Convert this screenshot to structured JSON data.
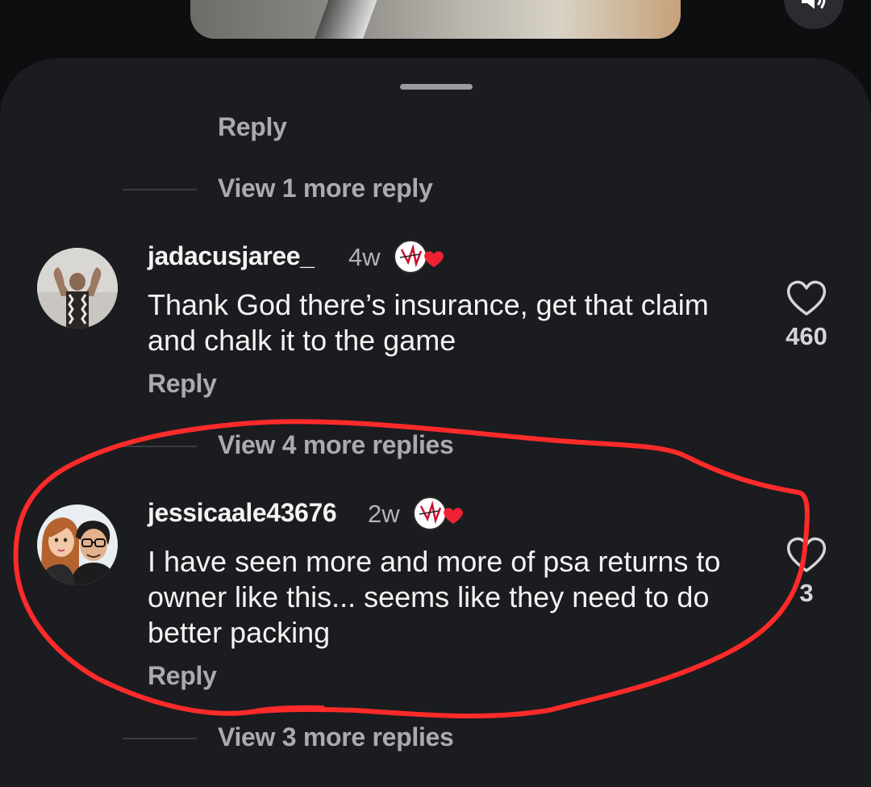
{
  "video": {
    "sound_icon": "speaker-icon"
  },
  "comments": {
    "prev_thread": {
      "reply_label": "Reply",
      "view_more_label": "View 1 more reply"
    },
    "items": [
      {
        "username": "jadacusjaree_",
        "time": "4w",
        "text": "Thank God there’s insurance, get that claim and chalk it to the game",
        "reply_label": "Reply",
        "likes": "460",
        "view_more_label": "View 4 more replies"
      },
      {
        "username": "jessicaale43676",
        "time": "2w",
        "text": "I have seen more and more of psa returns to owner like this... seems like they need to do better packing",
        "reply_label": "Reply",
        "likes": "3",
        "view_more_label": "View 3 more replies"
      }
    ]
  },
  "colors": {
    "sheet_bg": "#1b1c1f",
    "annotation_red": "#ff2a2a",
    "heart_badge": "#ee2233"
  }
}
